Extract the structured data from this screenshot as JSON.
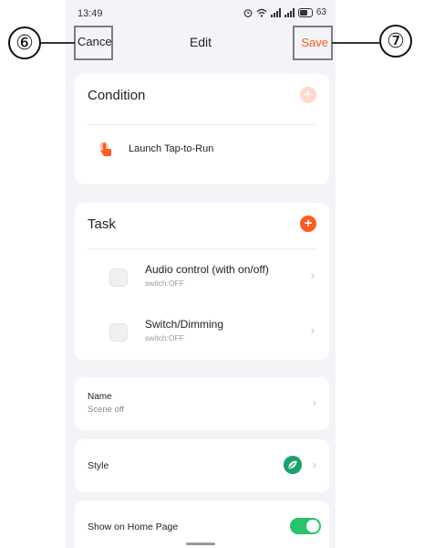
{
  "status_bar": {
    "time": "13:49",
    "battery": "63"
  },
  "nav": {
    "cancel_label": "Cance",
    "title": "Edit",
    "save_label": "Save"
  },
  "condition": {
    "title": "Condition",
    "item_label": "Launch Tap-to-Run"
  },
  "task": {
    "title": "Task",
    "items": [
      {
        "name": "Audio control (with on/off)",
        "state": "switch:OFF"
      },
      {
        "name": "Switch/Dimming",
        "state": "switch:OFF"
      }
    ]
  },
  "name_field": {
    "label": "Name",
    "value": "Scene off"
  },
  "style_field": {
    "label": "Style"
  },
  "home_field": {
    "label": "Show on Home Page",
    "toggle_on": true
  },
  "callouts": {
    "cancel_marker": "⑥",
    "save_marker": "⑦"
  },
  "colors": {
    "accent": "#ff5a1f",
    "toggle": "#27c46b",
    "style_icon": "#1aa36a"
  },
  "icons": {
    "add_condition": "plus-circle-icon",
    "add_task": "plus-circle-icon",
    "condition_item": "hand-tap-icon",
    "chevron": "chevron-right-icon",
    "style": "leaf-icon"
  }
}
